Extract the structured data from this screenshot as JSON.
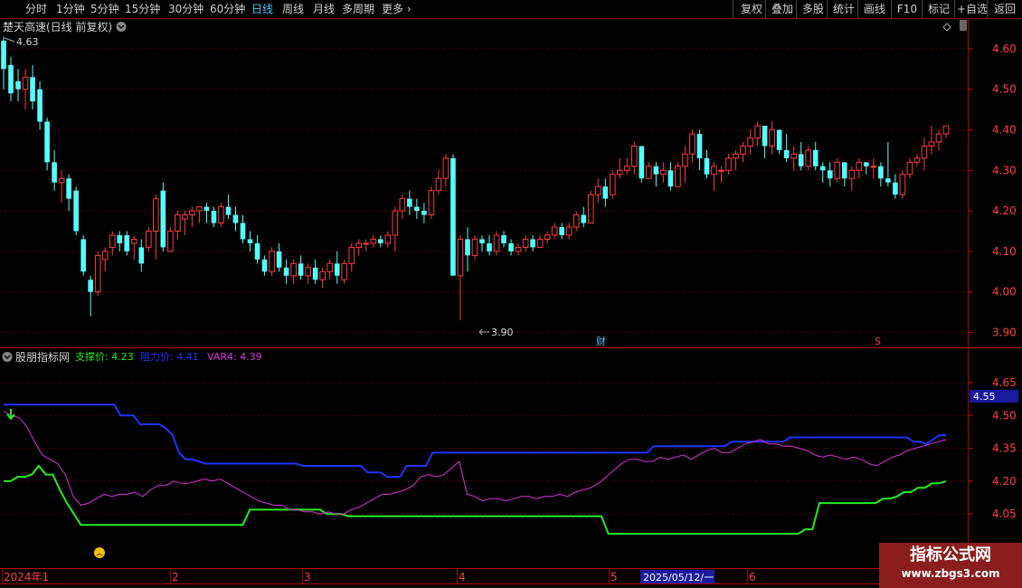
{
  "toolbar": {
    "periods": [
      "分时",
      "1分钟",
      "5分钟",
      "15分钟",
      "30分钟",
      "60分钟",
      "日线",
      "周线",
      "月线",
      "多周期",
      "更多"
    ],
    "active_period": "日线",
    "right_buttons": [
      "复权",
      "叠加",
      "多股",
      "统计",
      "画线",
      "F10",
      "标记",
      "+自选",
      "返回"
    ]
  },
  "main_panel": {
    "title": "楚天高速(日线 前复权)",
    "high_label": "4.63",
    "low_label": "3.90",
    "event_caicon": "财",
    "event_s": "S"
  },
  "indicator_panel": {
    "name": "股朋指标网",
    "legend": [
      {
        "label": "支撑价: 4.23",
        "color": "#22ee22"
      },
      {
        "label": "阻力价: 4.41",
        "color": "#2233ff"
      },
      {
        "label": "VAR4: 4.39",
        "color": "#dd33dd"
      }
    ],
    "current_value_box": "4.55"
  },
  "time_axis": {
    "labels": [
      "2024年1",
      "2",
      "3",
      "4",
      "5",
      "6"
    ],
    "cursor_date": "2025/05/12/一"
  },
  "watermark": {
    "line1": "指标公式网",
    "line2": "www.zbgs3.com"
  },
  "chart_data": {
    "type": "candlestick",
    "title": "楚天高速(日线 前复权)",
    "price_axis_ticks": [
      4.6,
      4.5,
      4.4,
      4.3,
      4.2,
      4.1,
      4.0,
      3.9
    ],
    "indicator_axis_ticks": [
      4.65,
      4.5,
      4.35,
      4.2,
      4.05
    ],
    "up_color": "#ff3c3c",
    "down_color": "#54ffff",
    "candles": [
      [
        4.62,
        4.63,
        4.5,
        4.55
      ],
      [
        4.56,
        4.58,
        4.47,
        4.49
      ],
      [
        4.52,
        4.55,
        4.47,
        4.5
      ],
      [
        4.5,
        4.55,
        4.45,
        4.53
      ],
      [
        4.53,
        4.56,
        4.45,
        4.47
      ],
      [
        4.5,
        4.52,
        4.4,
        4.42
      ],
      [
        4.42,
        4.43,
        4.3,
        4.32
      ],
      [
        4.32,
        4.35,
        4.25,
        4.27
      ],
      [
        4.27,
        4.3,
        4.22,
        4.28
      ],
      [
        4.28,
        4.29,
        4.2,
        4.23
      ],
      [
        4.25,
        4.26,
        4.14,
        4.15
      ],
      [
        4.13,
        4.14,
        4.04,
        4.05
      ],
      [
        4.03,
        4.04,
        3.94,
        4.0
      ],
      [
        4.0,
        4.1,
        3.99,
        4.09
      ],
      [
        4.08,
        4.11,
        4.05,
        4.1
      ],
      [
        4.11,
        4.15,
        4.09,
        4.14
      ],
      [
        4.14,
        4.15,
        4.1,
        4.12
      ],
      [
        4.14,
        4.15,
        4.09,
        4.1
      ],
      [
        4.12,
        4.14,
        4.08,
        4.13
      ],
      [
        4.11,
        4.13,
        4.05,
        4.07
      ],
      [
        4.11,
        4.16,
        4.1,
        4.15
      ],
      [
        4.15,
        4.24,
        4.08,
        4.23
      ],
      [
        4.25,
        4.27,
        4.1,
        4.11
      ],
      [
        4.1,
        4.16,
        4.1,
        4.15
      ],
      [
        4.15,
        4.2,
        4.13,
        4.19
      ],
      [
        4.18,
        4.2,
        4.14,
        4.19
      ],
      [
        4.19,
        4.21,
        4.16,
        4.2
      ],
      [
        4.2,
        4.21,
        4.17,
        4.21
      ],
      [
        4.21,
        4.22,
        4.17,
        4.2
      ],
      [
        4.2,
        4.21,
        4.16,
        4.17
      ],
      [
        4.17,
        4.22,
        4.16,
        4.21
      ],
      [
        4.21,
        4.24,
        4.18,
        4.19
      ],
      [
        4.19,
        4.21,
        4.15,
        4.17
      ],
      [
        4.17,
        4.19,
        4.12,
        4.13
      ],
      [
        4.13,
        4.15,
        4.1,
        4.12
      ],
      [
        4.12,
        4.14,
        4.07,
        4.08
      ],
      [
        4.08,
        4.09,
        4.04,
        4.05
      ],
      [
        4.05,
        4.11,
        4.04,
        4.1
      ],
      [
        4.1,
        4.12,
        4.05,
        4.06
      ],
      [
        4.06,
        4.08,
        4.02,
        4.04
      ],
      [
        4.04,
        4.08,
        4.02,
        4.07
      ],
      [
        4.07,
        4.09,
        4.03,
        4.04
      ],
      [
        4.04,
        4.07,
        4.02,
        4.06
      ],
      [
        4.06,
        4.08,
        4.02,
        4.03
      ],
      [
        4.03,
        4.06,
        4.01,
        4.05
      ],
      [
        4.05,
        4.08,
        4.03,
        4.07
      ],
      [
        4.07,
        4.1,
        4.02,
        4.04
      ],
      [
        4.03,
        4.08,
        4.02,
        4.07
      ],
      [
        4.07,
        4.12,
        4.05,
        4.11
      ],
      [
        4.11,
        4.13,
        4.09,
        4.12
      ],
      [
        4.12,
        4.13,
        4.1,
        4.12
      ],
      [
        4.12,
        4.14,
        4.11,
        4.13
      ],
      [
        4.13,
        4.14,
        4.11,
        4.12
      ],
      [
        4.12,
        4.15,
        4.11,
        4.14
      ],
      [
        4.14,
        4.21,
        4.1,
        4.2
      ],
      [
        4.2,
        4.24,
        4.18,
        4.23
      ],
      [
        4.23,
        4.25,
        4.19,
        4.21
      ],
      [
        4.21,
        4.23,
        4.18,
        4.2
      ],
      [
        4.2,
        4.22,
        4.17,
        4.19
      ],
      [
        4.19,
        4.26,
        4.18,
        4.25
      ],
      [
        4.25,
        4.3,
        4.24,
        4.28
      ],
      [
        4.28,
        4.34,
        4.26,
        4.33
      ],
      [
        4.33,
        4.34,
        4.04,
        4.04
      ],
      [
        4.04,
        4.14,
        3.93,
        4.13
      ],
      [
        4.13,
        4.16,
        4.05,
        4.09
      ],
      [
        4.09,
        4.14,
        4.08,
        4.13
      ],
      [
        4.13,
        4.14,
        4.1,
        4.12
      ],
      [
        4.12,
        4.14,
        4.09,
        4.1
      ],
      [
        4.1,
        4.15,
        4.09,
        4.14
      ],
      [
        4.14,
        4.15,
        4.11,
        4.12
      ],
      [
        4.12,
        4.13,
        4.09,
        4.1
      ],
      [
        4.1,
        4.12,
        4.09,
        4.11
      ],
      [
        4.11,
        4.14,
        4.1,
        4.13
      ],
      [
        4.13,
        4.14,
        4.1,
        4.11
      ],
      [
        4.11,
        4.14,
        4.11,
        4.13
      ],
      [
        4.13,
        4.15,
        4.12,
        4.14
      ],
      [
        4.14,
        4.17,
        4.13,
        4.16
      ],
      [
        4.16,
        4.17,
        4.13,
        4.14
      ],
      [
        4.14,
        4.17,
        4.13,
        4.16
      ],
      [
        4.16,
        4.2,
        4.15,
        4.19
      ],
      [
        4.19,
        4.21,
        4.16,
        4.17
      ],
      [
        4.17,
        4.25,
        4.17,
        4.24
      ],
      [
        4.24,
        4.28,
        4.22,
        4.26
      ],
      [
        4.26,
        4.28,
        4.21,
        4.23
      ],
      [
        4.24,
        4.3,
        4.23,
        4.29
      ],
      [
        4.29,
        4.33,
        4.28,
        4.3
      ],
      [
        4.3,
        4.33,
        4.29,
        4.31
      ],
      [
        4.31,
        4.37,
        4.29,
        4.36
      ],
      [
        4.36,
        4.36,
        4.27,
        4.28
      ],
      [
        4.28,
        4.32,
        4.28,
        4.31
      ],
      [
        4.31,
        4.32,
        4.26,
        4.29
      ],
      [
        4.29,
        4.32,
        4.27,
        4.3
      ],
      [
        4.3,
        4.32,
        4.25,
        4.26
      ],
      [
        4.26,
        4.32,
        4.26,
        4.31
      ],
      [
        4.31,
        4.36,
        4.27,
        4.34
      ],
      [
        4.34,
        4.4,
        4.32,
        4.39
      ],
      [
        4.39,
        4.4,
        4.3,
        4.33
      ],
      [
        4.33,
        4.35,
        4.28,
        4.29
      ],
      [
        4.29,
        4.32,
        4.25,
        4.31
      ],
      [
        4.3,
        4.31,
        4.27,
        4.3
      ],
      [
        4.3,
        4.34,
        4.29,
        4.33
      ],
      [
        4.33,
        4.35,
        4.3,
        4.34
      ],
      [
        4.34,
        4.37,
        4.32,
        4.36
      ],
      [
        4.36,
        4.4,
        4.34,
        4.38
      ],
      [
        4.38,
        4.42,
        4.36,
        4.41
      ],
      [
        4.41,
        4.41,
        4.33,
        4.36
      ],
      [
        4.36,
        4.42,
        4.34,
        4.4
      ],
      [
        4.4,
        4.4,
        4.34,
        4.35
      ],
      [
        4.35,
        4.39,
        4.32,
        4.33
      ],
      [
        4.33,
        4.36,
        4.3,
        4.34
      ],
      [
        4.34,
        4.37,
        4.3,
        4.31
      ],
      [
        4.31,
        4.36,
        4.3,
        4.35
      ],
      [
        4.35,
        4.37,
        4.3,
        4.31
      ],
      [
        4.31,
        4.32,
        4.27,
        4.3
      ],
      [
        4.3,
        4.32,
        4.26,
        4.28
      ],
      [
        4.28,
        4.33,
        4.27,
        4.32
      ],
      [
        4.32,
        4.32,
        4.26,
        4.28
      ],
      [
        4.28,
        4.31,
        4.25,
        4.3
      ],
      [
        4.3,
        4.33,
        4.28,
        4.32
      ],
      [
        4.32,
        4.32,
        4.29,
        4.31
      ],
      [
        4.31,
        4.33,
        4.28,
        4.31
      ],
      [
        4.31,
        4.32,
        4.26,
        4.28
      ],
      [
        4.28,
        4.37,
        4.26,
        4.27
      ],
      [
        4.27,
        4.29,
        4.23,
        4.24
      ],
      [
        4.24,
        4.3,
        4.23,
        4.29
      ],
      [
        4.29,
        4.33,
        4.28,
        4.32
      ],
      [
        4.32,
        4.34,
        4.31,
        4.33
      ],
      [
        4.33,
        4.38,
        4.3,
        4.36
      ],
      [
        4.36,
        4.41,
        4.34,
        4.37
      ],
      [
        4.37,
        4.4,
        4.35,
        4.39
      ],
      [
        4.39,
        4.41,
        4.38,
        4.41
      ]
    ],
    "support": [
      4.2,
      4.2,
      4.22,
      4.22,
      4.23,
      4.27,
      4.23,
      4.23,
      4.16,
      4.1,
      4.05,
      4.0,
      4.0,
      4.0,
      4.0,
      4.0,
      4.0,
      4.0,
      4.0,
      4.0,
      4.0,
      4.0,
      4.0,
      4.0,
      4.0,
      4.0,
      4.0,
      4.0,
      4.0,
      4.0,
      4.0,
      4.0,
      4.0,
      4.0,
      4.0,
      4.07,
      4.07,
      4.07,
      4.07,
      4.07,
      4.07,
      4.07,
      4.07,
      4.07,
      4.07,
      4.07,
      4.05,
      4.05,
      4.05,
      4.04,
      4.04,
      4.04,
      4.04,
      4.04,
      4.04,
      4.04,
      4.04,
      4.04,
      4.04,
      4.04,
      4.04,
      4.04,
      4.04,
      4.04,
      4.04,
      4.04,
      4.04,
      4.04,
      4.04,
      4.04,
      4.04,
      4.04,
      4.04,
      4.04,
      4.04,
      4.04,
      4.04,
      4.04,
      4.04,
      4.04,
      4.04,
      4.04,
      4.04,
      4.04,
      4.04,
      4.04,
      3.96,
      3.96,
      3.96,
      3.96,
      3.96,
      3.96,
      3.96,
      3.96,
      3.96,
      3.96,
      3.96,
      3.96,
      3.96,
      3.96,
      3.96,
      3.96,
      3.96,
      3.96,
      3.96,
      3.96,
      3.96,
      3.96,
      3.96,
      3.96,
      3.96,
      3.96,
      3.96,
      3.96,
      3.98,
      3.98,
      4.1,
      4.1,
      4.1,
      4.1,
      4.1,
      4.1,
      4.1,
      4.1,
      4.1,
      4.12,
      4.12,
      4.13,
      4.15,
      4.15,
      4.17,
      4.17,
      4.19,
      4.19,
      4.2
    ],
    "resistance": [
      4.55,
      4.55,
      4.55,
      4.55,
      4.55,
      4.55,
      4.55,
      4.55,
      4.55,
      4.55,
      4.55,
      4.55,
      4.55,
      4.55,
      4.55,
      4.55,
      4.55,
      4.55,
      4.5,
      4.5,
      4.5,
      4.46,
      4.46,
      4.46,
      4.46,
      4.44,
      4.41,
      4.33,
      4.3,
      4.3,
      4.29,
      4.28,
      4.28,
      4.28,
      4.28,
      4.28,
      4.28,
      4.28,
      4.28,
      4.28,
      4.28,
      4.28,
      4.28,
      4.28,
      4.28,
      4.28,
      4.27,
      4.27,
      4.27,
      4.27,
      4.27,
      4.27,
      4.27,
      4.27,
      4.27,
      4.27,
      4.24,
      4.24,
      4.24,
      4.22,
      4.22,
      4.22,
      4.27,
      4.27,
      4.27,
      4.27,
      4.33,
      4.33,
      4.33,
      4.33,
      4.33,
      4.33,
      4.33,
      4.33,
      4.33,
      4.33,
      4.33,
      4.33,
      4.33,
      4.33,
      4.33,
      4.33,
      4.33,
      4.33,
      4.33,
      4.33,
      4.33,
      4.33,
      4.33,
      4.33,
      4.33,
      4.33,
      4.33,
      4.33,
      4.33,
      4.33,
      4.33,
      4.33,
      4.33,
      4.33,
      4.36,
      4.36,
      4.36,
      4.36,
      4.36,
      4.36,
      4.36,
      4.36,
      4.36,
      4.36,
      4.36,
      4.36,
      4.38,
      4.38,
      4.38,
      4.38,
      4.38,
      4.38,
      4.38,
      4.38,
      4.38,
      4.4,
      4.4,
      4.4,
      4.4,
      4.4,
      4.4,
      4.4,
      4.4,
      4.4,
      4.4,
      4.4,
      4.4,
      4.4,
      4.4,
      4.4,
      4.4,
      4.4,
      4.4,
      4.4,
      4.38,
      4.38,
      4.37,
      4.39,
      4.41,
      4.41
    ],
    "var4": [
      4.52,
      4.5,
      4.49,
      4.45,
      4.38,
      4.32,
      4.3,
      4.28,
      4.23,
      4.13,
      4.09,
      4.1,
      4.12,
      4.14,
      4.13,
      4.14,
      4.14,
      4.15,
      4.13,
      4.16,
      4.18,
      4.18,
      4.2,
      4.19,
      4.19,
      4.2,
      4.21,
      4.2,
      4.21,
      4.19,
      4.17,
      4.15,
      4.13,
      4.11,
      4.1,
      4.09,
      4.09,
      4.07,
      4.07,
      4.06,
      4.06,
      4.05,
      4.06,
      4.05,
      4.05,
      4.07,
      4.08,
      4.1,
      4.12,
      4.14,
      4.14,
      4.15,
      4.16,
      4.18,
      4.22,
      4.23,
      4.22,
      4.23,
      4.26,
      4.29,
      4.14,
      4.13,
      4.11,
      4.12,
      4.12,
      4.11,
      4.12,
      4.13,
      4.13,
      4.12,
      4.13,
      4.13,
      4.14,
      4.13,
      4.15,
      4.16,
      4.17,
      4.19,
      4.22,
      4.25,
      4.28,
      4.3,
      4.3,
      4.29,
      4.29,
      4.31,
      4.3,
      4.31,
      4.32,
      4.3,
      4.32,
      4.34,
      4.35,
      4.33,
      4.33,
      4.35,
      4.37,
      4.38,
      4.39,
      4.37,
      4.37,
      4.36,
      4.36,
      4.35,
      4.34,
      4.32,
      4.31,
      4.32,
      4.31,
      4.3,
      4.31,
      4.3,
      4.28,
      4.27,
      4.29,
      4.31,
      4.32,
      4.34,
      4.35,
      4.36,
      4.37,
      4.38,
      4.39
    ]
  }
}
